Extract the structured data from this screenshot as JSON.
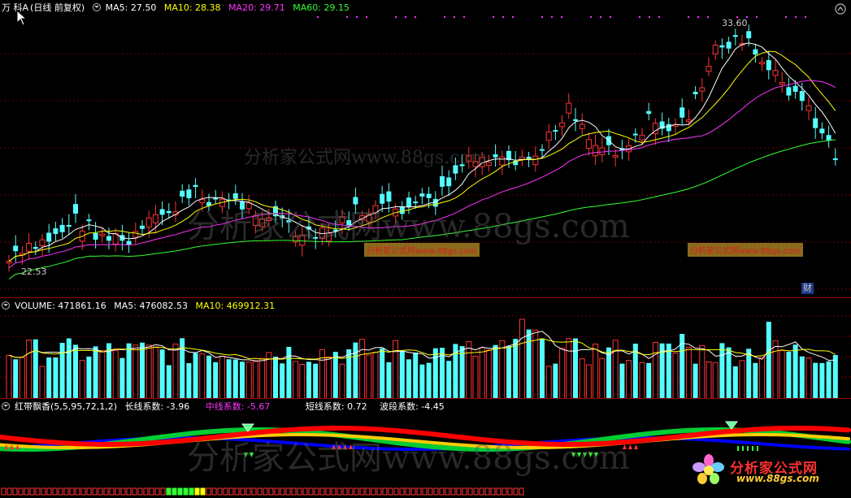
{
  "price_panel": {
    "stock_name": "万 科A",
    "adjust_mode": "(日线 前复权)",
    "ma5": "MA5: 27.50",
    "ma10": "MA10: 28.38",
    "ma20": "MA20: 29.71",
    "ma60": "MA60: 29.15",
    "high_label": "33.60",
    "low_label": "22.53",
    "cai_badge": "财",
    "colors": {
      "ma5": "#ffffff",
      "ma10": "#ffff00",
      "ma20": "#ff33ff",
      "ma60": "#33ff33",
      "up": "#ff3333",
      "down": "#54ffff"
    }
  },
  "volume_panel": {
    "volume": "VOLUME: 471861.16",
    "ma5": "MA5: 476082.53",
    "ma10": "MA10: 469912.31"
  },
  "indicator_panel": {
    "name": "红带飘香(5,5,95,72,1,2)",
    "long": "长线系数: -3.96",
    "mid": "中线系数: -5.67",
    "short": "短线系数: 0.72",
    "wave": "波段系数: -4.45"
  },
  "watermarks": {
    "main": "分析家公式网www.88gs.com",
    "tag1": "分析家公式网www.88gs.com",
    "tag2": "分析家公式网www.88gs.com"
  },
  "logo": {
    "title": "分析家公式网",
    "url": "www.88gs.com"
  }
}
